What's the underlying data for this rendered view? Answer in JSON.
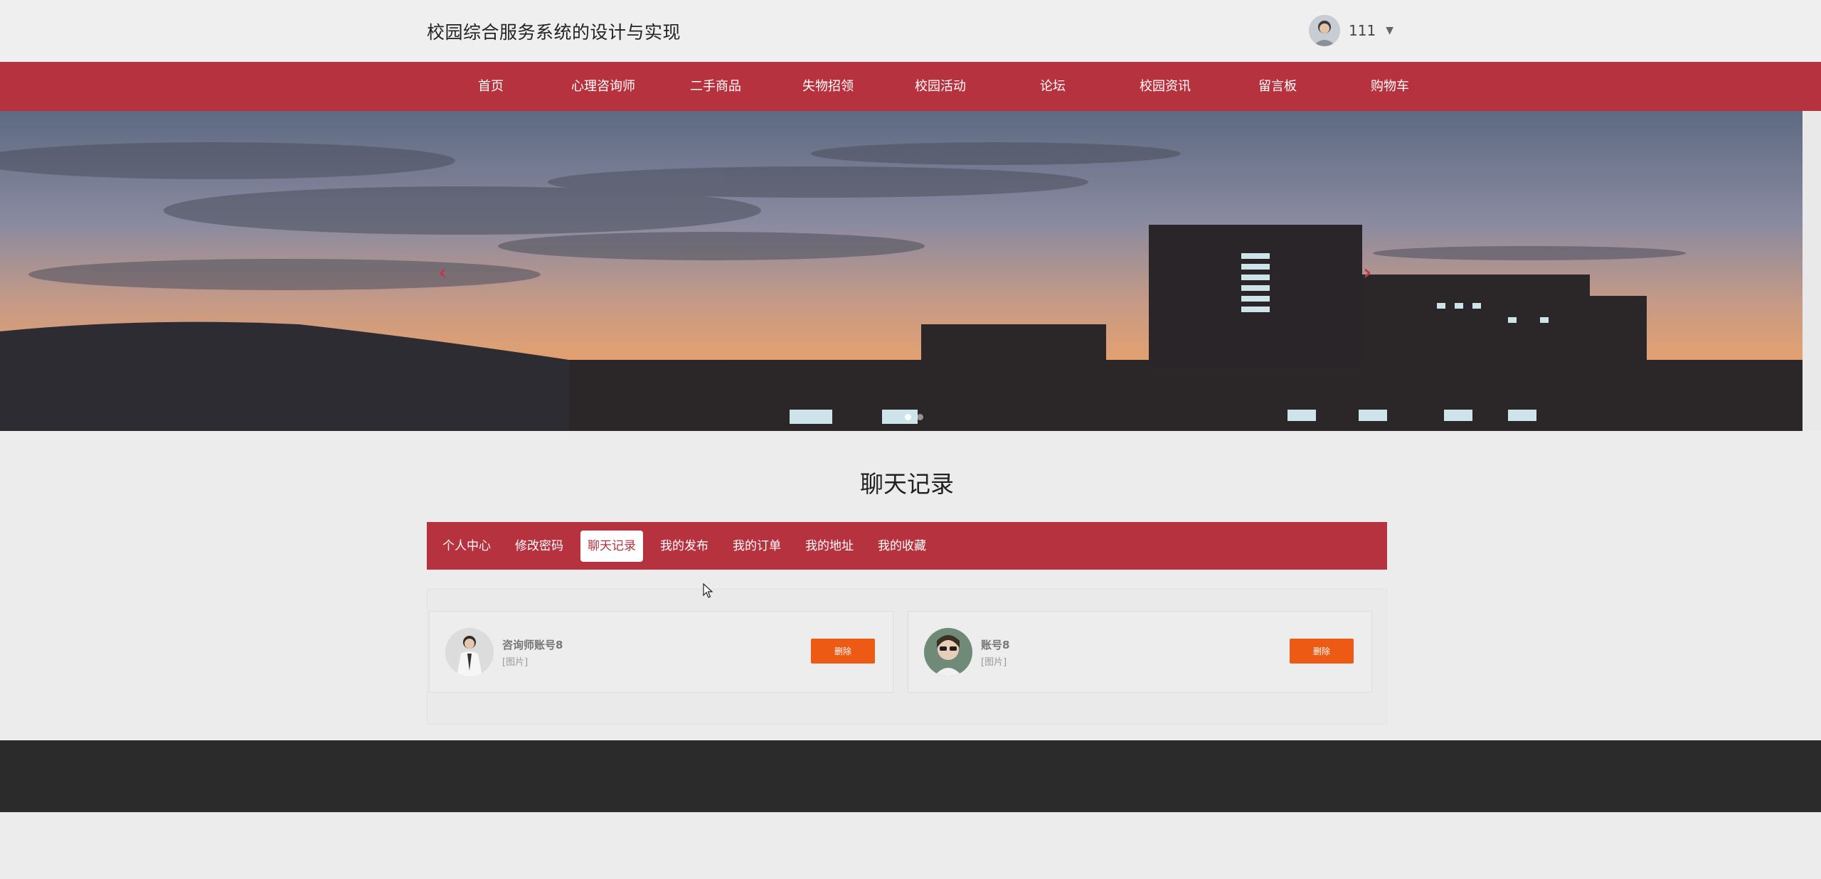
{
  "header": {
    "site_title": "校园综合服务系统的设计与实现",
    "user_name": "111"
  },
  "nav": {
    "items": [
      {
        "label": "首页"
      },
      {
        "label": "心理咨询师"
      },
      {
        "label": "二手商品"
      },
      {
        "label": "失物招领"
      },
      {
        "label": "校园活动"
      },
      {
        "label": "论坛"
      },
      {
        "label": "校园资讯"
      },
      {
        "label": "留言板"
      },
      {
        "label": "购物车"
      }
    ]
  },
  "banner": {
    "prev_icon": "chevron-left-icon",
    "next_icon": "chevron-right-icon",
    "active_slide": 1,
    "slide_count": 2
  },
  "section": {
    "title": "聊天记录"
  },
  "tabs": {
    "items": [
      {
        "label": "个人中心",
        "active": false
      },
      {
        "label": "修改密码",
        "active": false
      },
      {
        "label": "聊天记录",
        "active": true
      },
      {
        "label": "我的发布",
        "active": false
      },
      {
        "label": "我的订单",
        "active": false
      },
      {
        "label": "我的地址",
        "active": false
      },
      {
        "label": "我的收藏",
        "active": false
      }
    ]
  },
  "chats": [
    {
      "name": "咨询师账号8",
      "last_message": "[图片]",
      "delete_label": "删除"
    },
    {
      "name": "账号8",
      "last_message": "[图片]",
      "delete_label": "删除"
    }
  ],
  "colors": {
    "brand": "#b7323f",
    "delete_button": "#ec5a14",
    "footer": "#2b2b2b",
    "background": "#ececec"
  }
}
